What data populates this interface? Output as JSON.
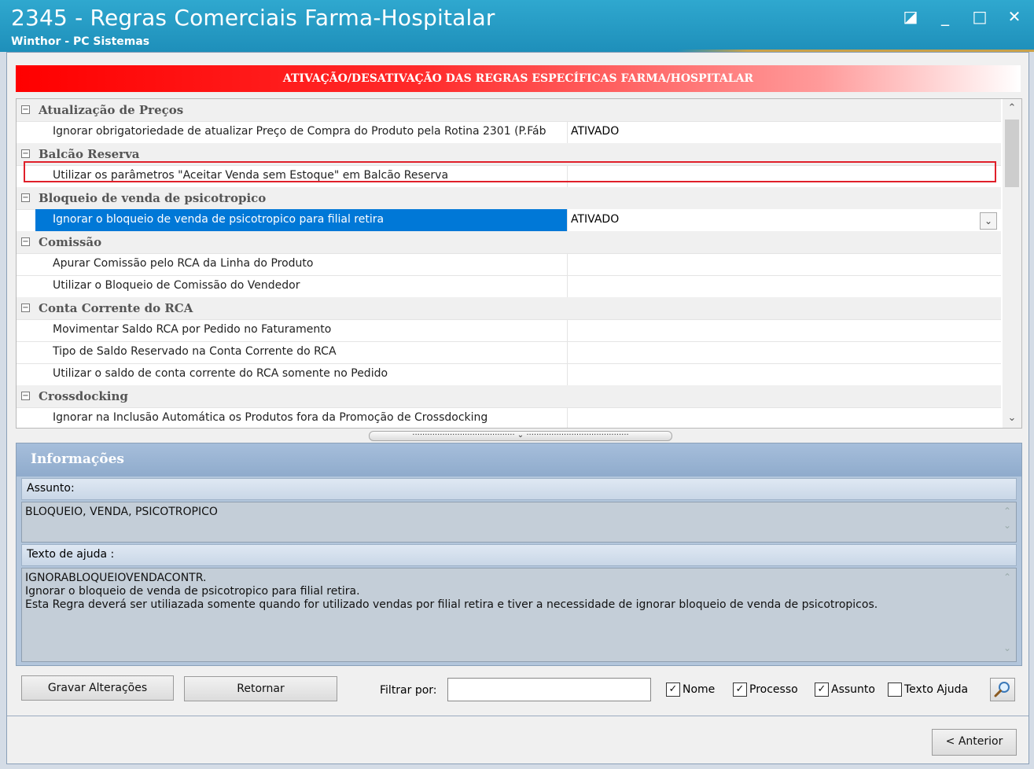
{
  "window": {
    "title": "2345 - Regras Comerciais Farma-Hospitalar",
    "subtitle": "Winthor - PC Sistemas"
  },
  "banner": "ATIVAÇÃO/DESATIVAÇÃO DAS REGRAS ESPECÍFICAS FARMA/HOSPITALAR",
  "grid": {
    "rows": [
      {
        "type": "category",
        "label": "Atualização de Preços"
      },
      {
        "type": "item",
        "name": "Ignorar obrigatoriedade de atualizar Preço de Compra do Produto pela Rotina 2301 (P.Fáb",
        "value": "ATIVADO"
      },
      {
        "type": "category",
        "label": "Balcão Reserva"
      },
      {
        "type": "item",
        "name": "Utilizar os parâmetros \"Aceitar Venda sem Estoque\" em Balcão Reserva",
        "value": ""
      },
      {
        "type": "category",
        "label": "Bloqueio de venda de psicotropico"
      },
      {
        "type": "item",
        "name": "Ignorar o bloqueio de venda de psicotropico para filial retira",
        "value": "ATIVADO",
        "selected": true
      },
      {
        "type": "category",
        "label": "Comissão"
      },
      {
        "type": "item",
        "name": "Apurar Comissão pelo RCA da Linha do Produto",
        "value": ""
      },
      {
        "type": "item",
        "name": "Utilizar o Bloqueio de Comissão do Vendedor",
        "value": ""
      },
      {
        "type": "category",
        "label": "Conta Corrente do RCA"
      },
      {
        "type": "item",
        "name": "Movimentar Saldo RCA por Pedido no Faturamento",
        "value": ""
      },
      {
        "type": "item",
        "name": "Tipo de Saldo Reservado na Conta Corrente do RCA",
        "value": ""
      },
      {
        "type": "item",
        "name": "Utilizar o saldo de conta corrente do RCA somente no Pedido",
        "value": ""
      },
      {
        "type": "category",
        "label": "Crossdocking"
      },
      {
        "type": "item",
        "name": "Ignorar na Inclusão Automática os Produtos fora da Promoção de Crossdocking",
        "value": ""
      }
    ]
  },
  "info": {
    "header": "Informações",
    "assunto_label": "Assunto:",
    "assunto_value": "BLOQUEIO, VENDA, PSICOTROPICO",
    "ajuda_label": "Texto de ajuda :",
    "ajuda_lines": [
      "IGNORABLOQUEIOVENDACONTR.",
      "Ignorar o bloqueio de venda de psicotropico para filial retira.",
      "Esta Regra deverá ser utiliazada somente quando for utilizado vendas por filial retira e tiver a necessidade de ignorar bloqueio de venda de psicotropicos."
    ]
  },
  "toolbar": {
    "save_label": "Gravar Alterações",
    "return_label": "Retornar",
    "filter_label": "Filtrar por:",
    "filter_value": "",
    "checkboxes": [
      {
        "label": "Nome",
        "checked": true
      },
      {
        "label": "Processo",
        "checked": true
      },
      {
        "label": "Assunto",
        "checked": true
      },
      {
        "label": "Texto Ajuda",
        "checked": false
      }
    ]
  },
  "nav": {
    "previous_label": "< Anterior"
  },
  "icons": {
    "expander": "minus-box-icon",
    "dropdown": "chevron-down-icon",
    "search": "magnifier-icon"
  }
}
